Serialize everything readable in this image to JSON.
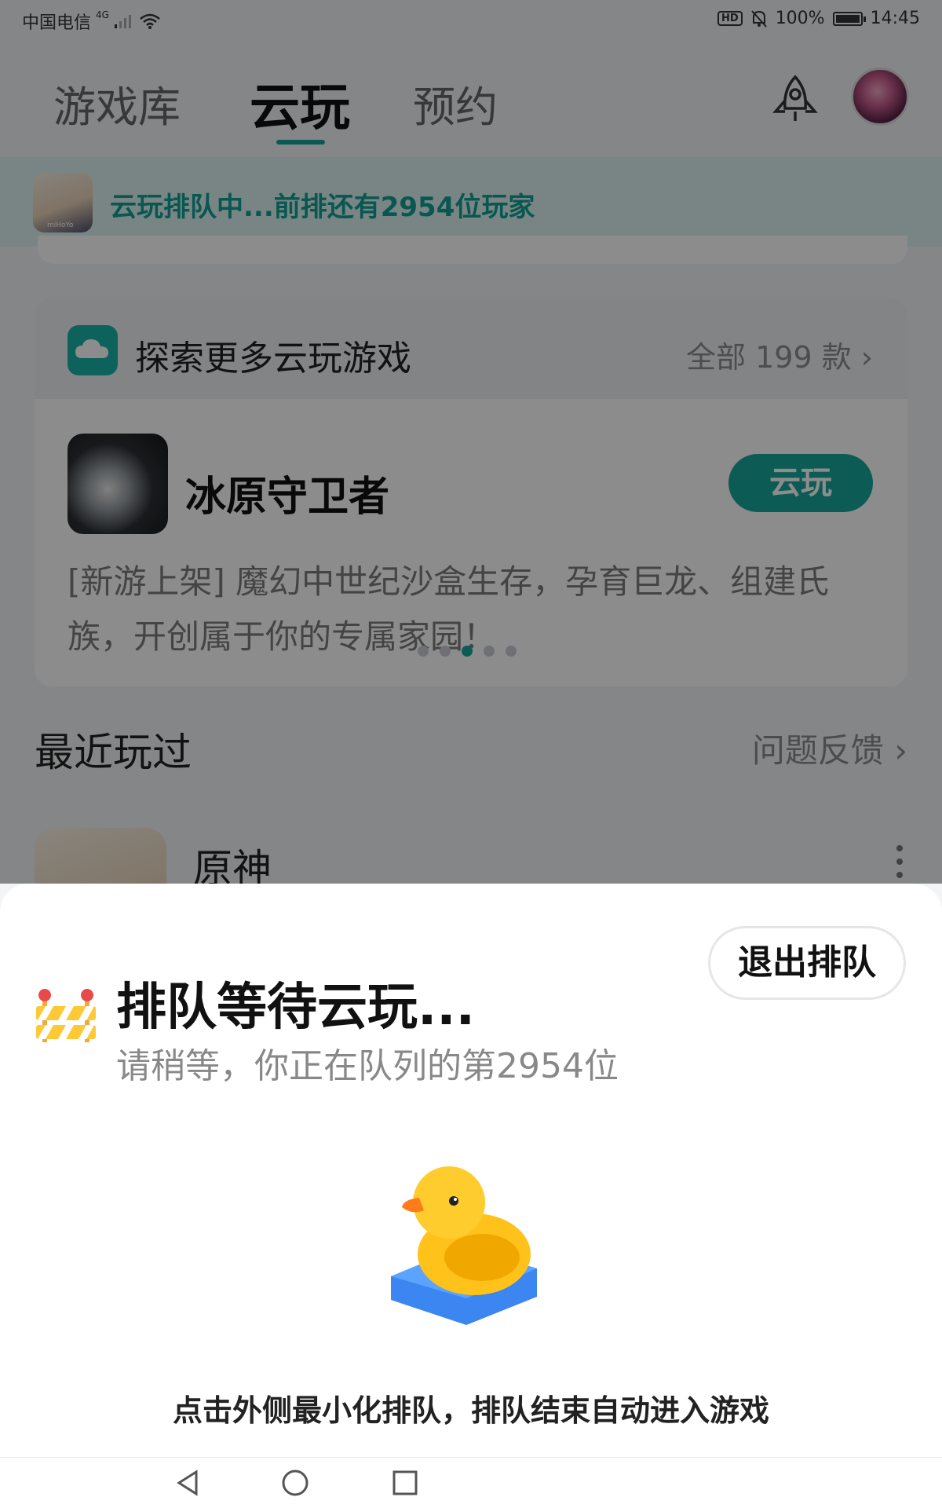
{
  "status_bar": {
    "carrier": "中国电信",
    "network": "4G",
    "battery": "100%",
    "battery_level": 1.0,
    "time": "14:45",
    "hd_badge": "HD"
  },
  "tabs": [
    {
      "label": "游戏库",
      "active": false
    },
    {
      "label": "云玩",
      "active": true
    },
    {
      "label": "预约",
      "active": false
    }
  ],
  "queue_banner": {
    "text": "云玩排队中...前排还有2954位玩家",
    "icon_caption": "miHoYo"
  },
  "explore": {
    "title": "探索更多云玩游戏",
    "all_link": "全部 199 款 ›",
    "game_title": "冰原守卫者",
    "play_button": "云玩",
    "description": "[新游上架] 魔幻中世纪沙盒生存，孕育巨龙、组建氏族，开创属于你的专属家园！",
    "carousel_pages": 5,
    "carousel_active_index": 2
  },
  "recent": {
    "title": "最近玩过",
    "feedback_link": "问题反馈 ›",
    "game_name": "原神"
  },
  "sheet": {
    "exit_button": "退出排队",
    "title": "排队等待云玩...",
    "subtitle": "请稍等，你正在队列的第2954位",
    "hint": "点击外侧最小化排队，排队结束自动进入游戏"
  },
  "colors": {
    "accent": "#16a89c",
    "banner_bg": "#dbf3f0",
    "banner_text": "#0f9e93"
  },
  "icons": [
    "rocket-icon",
    "cloud-icon",
    "barrier-icon",
    "duck-illustration",
    "more-icon",
    "back-icon",
    "home-icon",
    "recents-icon"
  ]
}
